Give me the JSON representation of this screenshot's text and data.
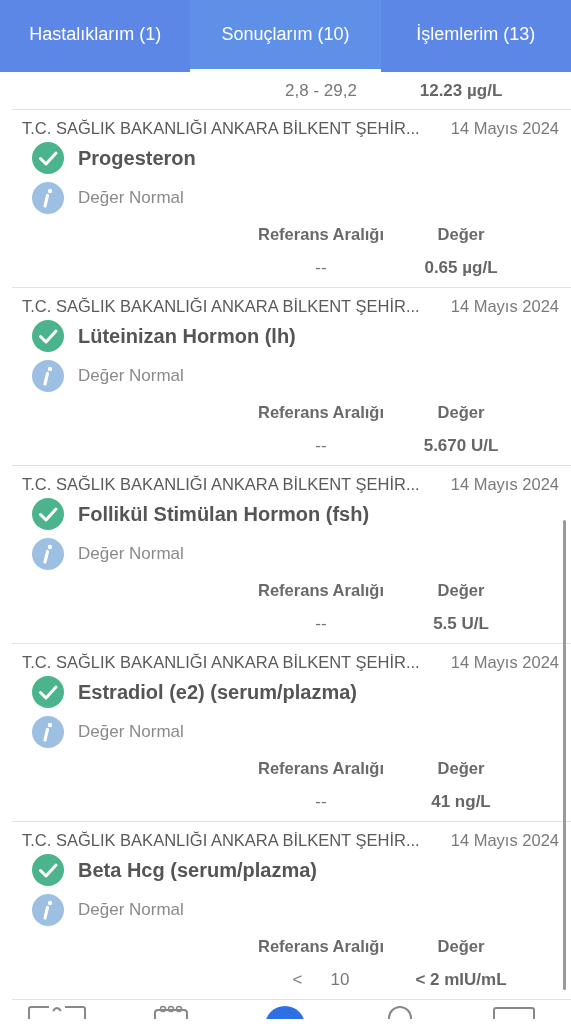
{
  "tabs": [
    {
      "label": "Hastalıklarım (1)",
      "selected": false
    },
    {
      "label": "Sonuçlarım (10)",
      "selected": true
    },
    {
      "label": "İşlemlerim (13)",
      "selected": false
    }
  ],
  "partial_result": {
    "reference_parts": [
      "2,8 - 29,2"
    ],
    "value": "12.23 µg/L"
  },
  "results": [
    {
      "source": "T.C. SAĞLIK BAKANLIĞI ANKARA BİLKENT ŞEHİR...",
      "date": "14 Mayıs 2024",
      "name": "Progesteron",
      "kind": "check",
      "note": "Değer Normal",
      "reference_label": "Referans Aralığı",
      "value_label": "Değer",
      "reference_parts": [
        "--"
      ],
      "value": "0.65 µg/L"
    },
    {
      "source": "T.C. SAĞLIK BAKANLIĞI ANKARA BİLKENT ŞEHİR...",
      "date": "14 Mayıs 2024",
      "name": "Lüteinizan Hormon (lh)",
      "kind": "check",
      "note": "Değer Normal",
      "reference_label": "Referans Aralığı",
      "value_label": "Değer",
      "reference_parts": [
        "--"
      ],
      "value": "5.670 U/L"
    },
    {
      "source": "T.C. SAĞLIK BAKANLIĞI ANKARA BİLKENT ŞEHİR...",
      "date": "14 Mayıs 2024",
      "name": "Follikül Stimülan Hormon (fsh)",
      "kind": "check",
      "note": "Değer Normal",
      "reference_label": "Referans Aralığı",
      "value_label": "Değer",
      "reference_parts": [
        "--"
      ],
      "value": "5.5 U/L"
    },
    {
      "source": "T.C. SAĞLIK BAKANLIĞI ANKARA BİLKENT ŞEHİR...",
      "date": "14 Mayıs 2024",
      "name": "Estradiol (e2) (serum/plazma)",
      "kind": "check",
      "note": "Değer Normal",
      "reference_label": "Referans Aralığı",
      "value_label": "Değer",
      "reference_parts": [
        "--"
      ],
      "value": "41 ng/L"
    },
    {
      "source": "T.C. SAĞLIK BAKANLIĞI ANKARA BİLKENT ŞEHİR...",
      "date": "14 Mayıs 2024",
      "name": "Beta Hcg (serum/plazma)",
      "kind": "check",
      "note": "Değer Normal",
      "reference_label": "Referans Aralığı",
      "value_label": "Değer",
      "reference_parts": [
        "<",
        "10"
      ],
      "value": "< 2 mIU/mL"
    }
  ]
}
